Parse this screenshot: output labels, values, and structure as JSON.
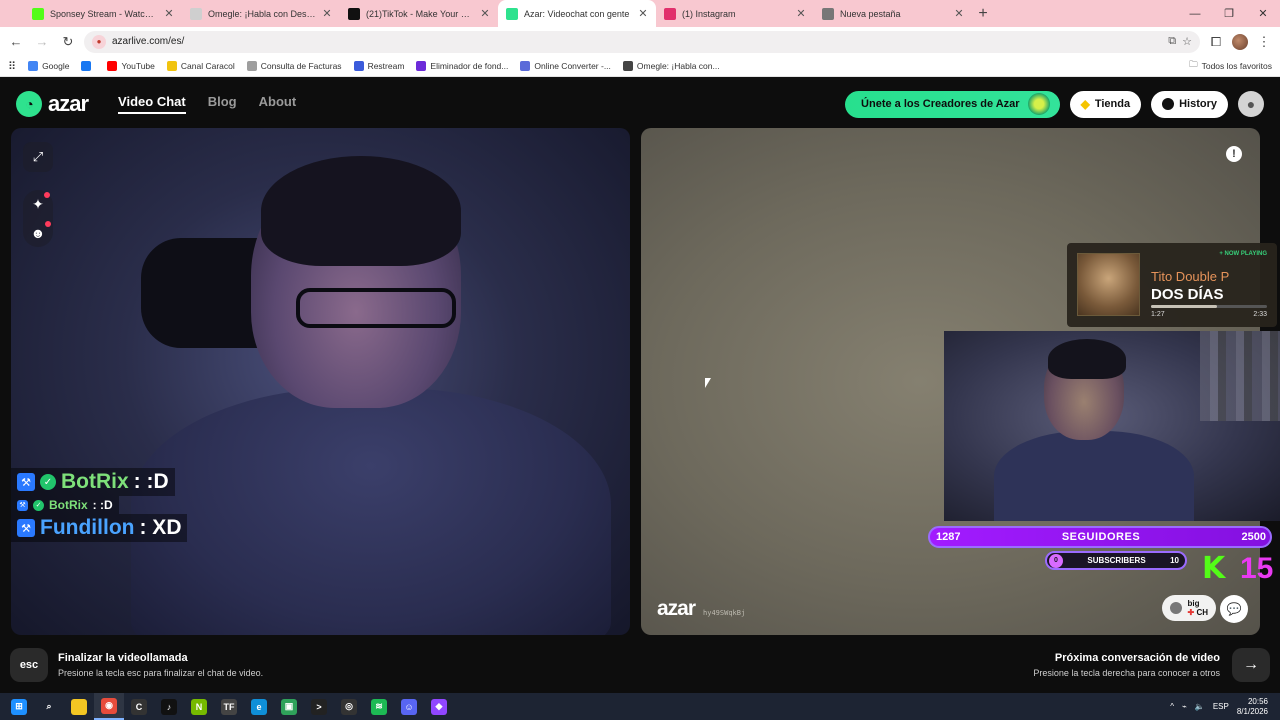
{
  "browser": {
    "tabs": [
      {
        "label": "Sponsey Stream - Watch Live o",
        "icon_color": "#53fc18",
        "active": false
      },
      {
        "label": "Omegle: ¡Habla con Desconoc",
        "icon_color": "#cfcfcf",
        "active": false
      },
      {
        "label": "(21)TikTok - Make Your Day",
        "icon_color": "#111111",
        "active": false
      },
      {
        "label": "Azar: Videochat con gente",
        "icon_color": "#2ee28e",
        "active": true
      },
      {
        "label": "(1) Instagram",
        "icon_color": "#e1306c",
        "active": false
      },
      {
        "label": "Nueva pestaña",
        "icon_color": "#777777",
        "active": false
      }
    ],
    "url": "azarlive.com/es/",
    "bookmarks": [
      {
        "label": "Google",
        "icon_color": "#4285f4"
      },
      {
        "label": "",
        "icon_color": "#1877f2"
      },
      {
        "label": "YouTube",
        "icon_color": "#ff0000"
      },
      {
        "label": "Canal Caracol",
        "icon_color": "#f1c40f"
      },
      {
        "label": "Consulta de Facturas",
        "icon_color": "#9e9e9e"
      },
      {
        "label": "Restream",
        "icon_color": "#3b5bdb"
      },
      {
        "label": "Eliminador de fond...",
        "icon_color": "#6c2bd9"
      },
      {
        "label": "Online Converter -...",
        "icon_color": "#5b6bd9"
      },
      {
        "label": "Omegle: ¡Habla con...",
        "icon_color": "#444444"
      }
    ],
    "all_bookmarks_label": "Todos los favoritos"
  },
  "azar": {
    "logo_text": "azar",
    "nav": {
      "video_chat": "Video Chat",
      "blog": "Blog",
      "about": "About"
    },
    "creators_button": "Únete a los Creadores de Azar",
    "shop_button": "Tienda",
    "history_button": "History",
    "chat_overlay": [
      {
        "user": "BotRix",
        "message": " : :D",
        "size": "large",
        "color": "green"
      },
      {
        "user": "BotRix",
        "message": " : :D",
        "size": "small",
        "color": "green"
      },
      {
        "user": "Fundillon",
        "message": " : XD",
        "size": "large",
        "color": "blue"
      }
    ],
    "watermark": "azar",
    "partner_id": "hy49SWqkBj",
    "partner_name": "big",
    "partner_country": "CH",
    "footer": {
      "esc_key": "esc",
      "end_title": "Finalizar la videollamada",
      "end_sub": "Presione la tecla esc para finalizar el chat de video.",
      "next_title": "Próxima conversación de video",
      "next_sub": "Presione la tecla derecha para conocer a otros"
    }
  },
  "stream_overlay": {
    "now_playing_tag": "+ NOW PLAYING",
    "artist": "Tito Double P",
    "song": "DOS DÍAS",
    "elapsed": "1:27",
    "duration": "2:33",
    "progress": 0.57,
    "followers_current": "1287",
    "followers_label": "SEGUIDORES",
    "followers_goal": "2500",
    "subs_current": "0",
    "subs_label": "SUBSCRIBERS",
    "subs_goal": "10",
    "kick_letter": "K",
    "kick_number": "15"
  },
  "taskbar": {
    "apps": [
      {
        "name": "windows-start-icon",
        "color": "#1e90ff",
        "glyph": "⊞"
      },
      {
        "name": "search-icon",
        "color": "transparent",
        "glyph": "⌕"
      },
      {
        "name": "file-explorer-icon",
        "color": "#f3c623",
        "glyph": ""
      },
      {
        "name": "chrome-icon",
        "color": "#e74c3c",
        "glyph": "◉"
      },
      {
        "name": "call-of-duty-icon",
        "color": "#333333",
        "glyph": "C"
      },
      {
        "name": "tiktok-icon",
        "color": "#111111",
        "glyph": "♪"
      },
      {
        "name": "nvidia-icon",
        "color": "#76b900",
        "glyph": "N"
      },
      {
        "name": "tf-icon",
        "color": "#444444",
        "glyph": "TF"
      },
      {
        "name": "edge-icon",
        "color": "#0f8fd8",
        "glyph": "e"
      },
      {
        "name": "app-green-icon",
        "color": "#2fa15a",
        "glyph": "▣"
      },
      {
        "name": "terminal-icon",
        "color": "#222222",
        "glyph": ">"
      },
      {
        "name": "obs-icon",
        "color": "#333333",
        "glyph": "◎"
      },
      {
        "name": "spotify-icon",
        "color": "#1db954",
        "glyph": "≋"
      },
      {
        "name": "discord-icon",
        "color": "#5865f2",
        "glyph": "☺"
      },
      {
        "name": "twitch-studio-icon",
        "color": "#9146ff",
        "glyph": "◆"
      }
    ],
    "language": "ESP",
    "time": "20:56",
    "date": "8/1/2026"
  }
}
